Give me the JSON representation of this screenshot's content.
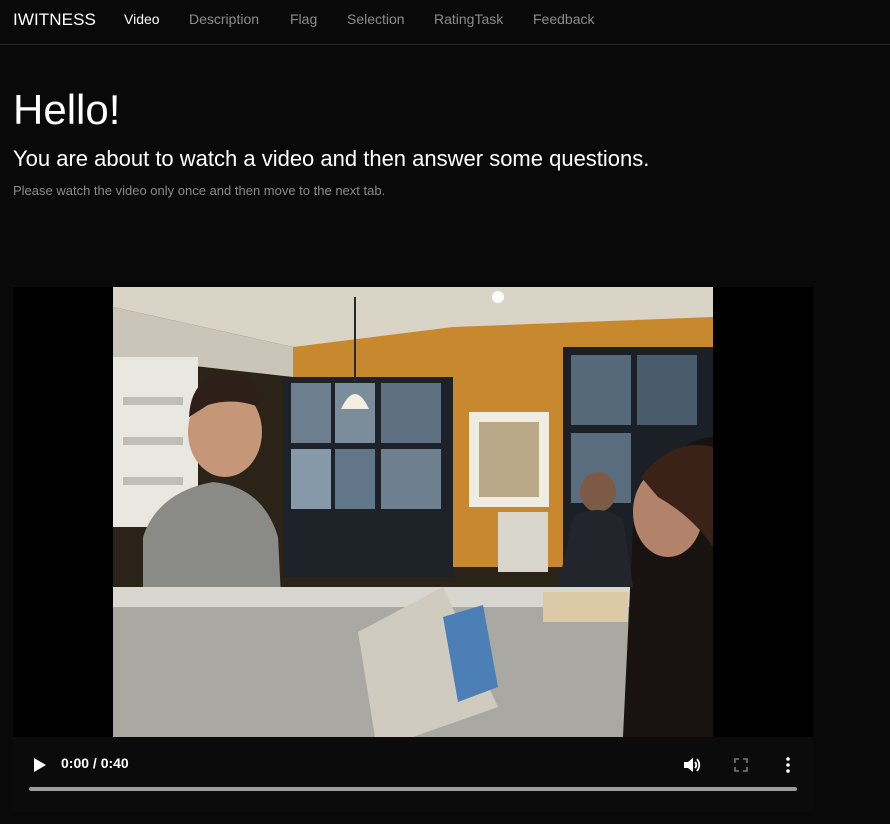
{
  "navbar": {
    "brand": "IWITNESS",
    "items": [
      {
        "label": "Video",
        "active": true
      },
      {
        "label": "Description",
        "active": false
      },
      {
        "label": "Flag",
        "active": false
      },
      {
        "label": "Selection",
        "active": false
      },
      {
        "label": "RatingTask",
        "active": false
      },
      {
        "label": "Feedback",
        "active": false
      }
    ]
  },
  "main": {
    "heading": "Hello!",
    "subtitle": "You are about to watch a video and then answer some questions.",
    "instruction": "Please watch the video only once and then move to the next tab."
  },
  "video": {
    "time_display": "0:00 / 0:40",
    "progress_fraction": 0,
    "icons": {
      "play": "play-icon",
      "volume": "volume-icon",
      "fullscreen": "fullscreen-icon",
      "more": "more-options-icon"
    }
  },
  "colors": {
    "background": "#090909",
    "text_primary": "#ffffff",
    "text_muted": "#8c8c8c"
  }
}
